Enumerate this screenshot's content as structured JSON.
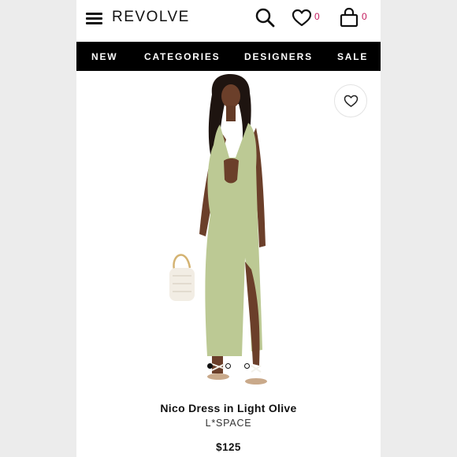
{
  "header": {
    "logo": "REVOLVE",
    "wishlist_count": "0",
    "cart_count": "0",
    "accent_color": "#c2185b"
  },
  "nav": {
    "items": [
      "NEW",
      "CATEGORIES",
      "DESIGNERS",
      "SALE"
    ]
  },
  "icons": [
    "menu-icon",
    "search-icon",
    "heart-icon",
    "bag-icon",
    "heart-outline-icon"
  ],
  "product": {
    "name": "Nico Dress in Light Olive",
    "brand": "L*SPACE",
    "price": "$125",
    "dress_color": "#bcc994"
  },
  "carousel": {
    "total": 3,
    "active_index": 1
  }
}
